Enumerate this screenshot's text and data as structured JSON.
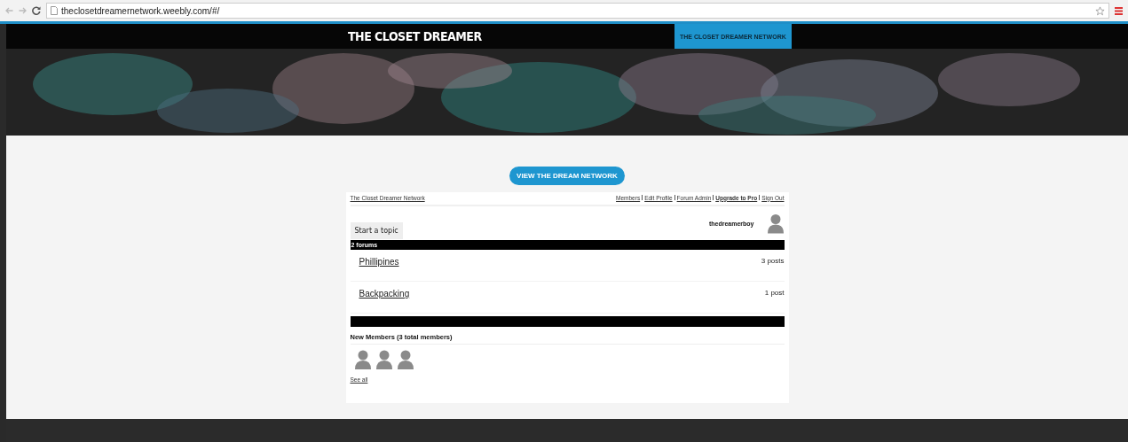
{
  "browser": {
    "url": "theclosetdreamernetwork.weebly.com/#/"
  },
  "header": {
    "logo": "THE CLOSET DREAMER",
    "nav_items": [
      {
        "label": "THE CLOSET DREAMER NETWORK",
        "selected": true
      }
    ]
  },
  "cta_button": "VIEW THE DREAM NETWORK",
  "forum": {
    "breadcrumb": "The Closet Dreamer Network",
    "user_links": [
      {
        "label": "Members",
        "emphasized": false
      },
      {
        "label": "Edit Profile",
        "emphasized": false
      },
      {
        "label": "Forum Admin",
        "emphasized": false
      },
      {
        "label": "Upgrade to Pro",
        "emphasized": true
      },
      {
        "label": "Sign Out",
        "emphasized": false
      }
    ],
    "username": "thedreamerboy",
    "start_button": "Start a topic",
    "forums_header": "2 forums",
    "forums": [
      {
        "name": "Phillipines",
        "posts": "3 posts"
      },
      {
        "name": "Backpacking",
        "posts": "1 post"
      }
    ],
    "members_title": "New Members (3 total members)",
    "members": [
      {
        "kind": "avatar"
      },
      {
        "kind": "avatar"
      },
      {
        "kind": "avatar"
      }
    ],
    "see_all": "See all"
  }
}
